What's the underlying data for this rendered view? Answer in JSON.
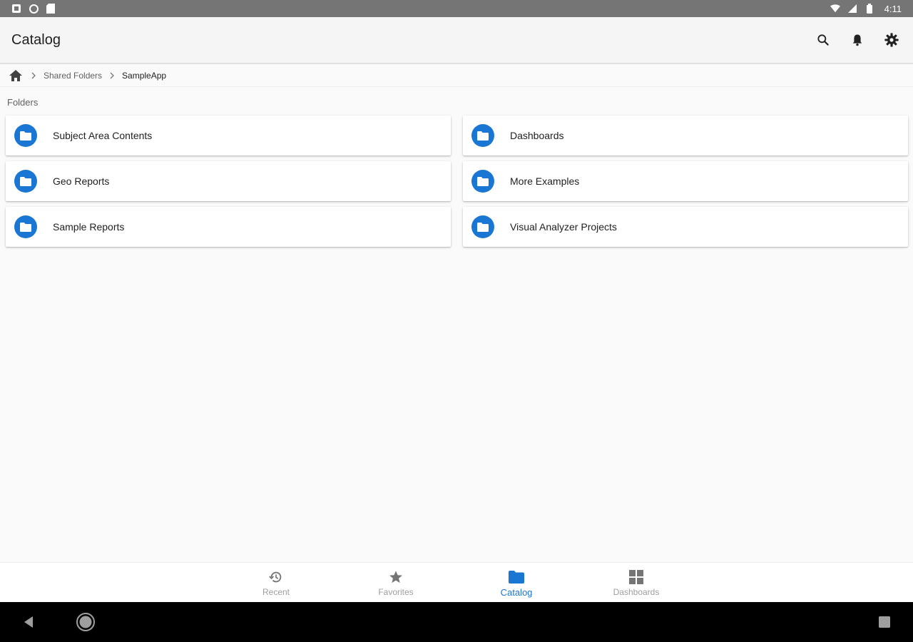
{
  "status_bar": {
    "time": "4:11",
    "left_icons": [
      "notification-icon",
      "sync-icon",
      "sd-card-icon"
    ],
    "right_icons": [
      "wifi-icon",
      "cellular-icon",
      "battery-icon"
    ]
  },
  "app_bar": {
    "title": "Catalog",
    "actions": [
      "search-icon",
      "bell-icon",
      "gear-icon"
    ]
  },
  "breadcrumb": {
    "items": [
      "Shared Folders",
      "SampleApp"
    ]
  },
  "section": {
    "label": "Folders"
  },
  "folders": [
    {
      "name": "Subject Area Contents"
    },
    {
      "name": "Dashboards"
    },
    {
      "name": "Geo Reports"
    },
    {
      "name": "More Examples"
    },
    {
      "name": "Sample Reports"
    },
    {
      "name": "Visual Analyzer Projects"
    }
  ],
  "bottom_nav": {
    "items": [
      {
        "label": "Recent",
        "icon": "history-icon"
      },
      {
        "label": "Favorites",
        "icon": "star-icon"
      },
      {
        "label": "Catalog",
        "icon": "folder-icon"
      },
      {
        "label": "Dashboards",
        "icon": "grid-icon"
      }
    ],
    "active": "Catalog"
  },
  "colors": {
    "accent": "#1976d2",
    "status_bar": "#757575",
    "app_bar": "#f5f5f5",
    "background": "#fafafa"
  }
}
